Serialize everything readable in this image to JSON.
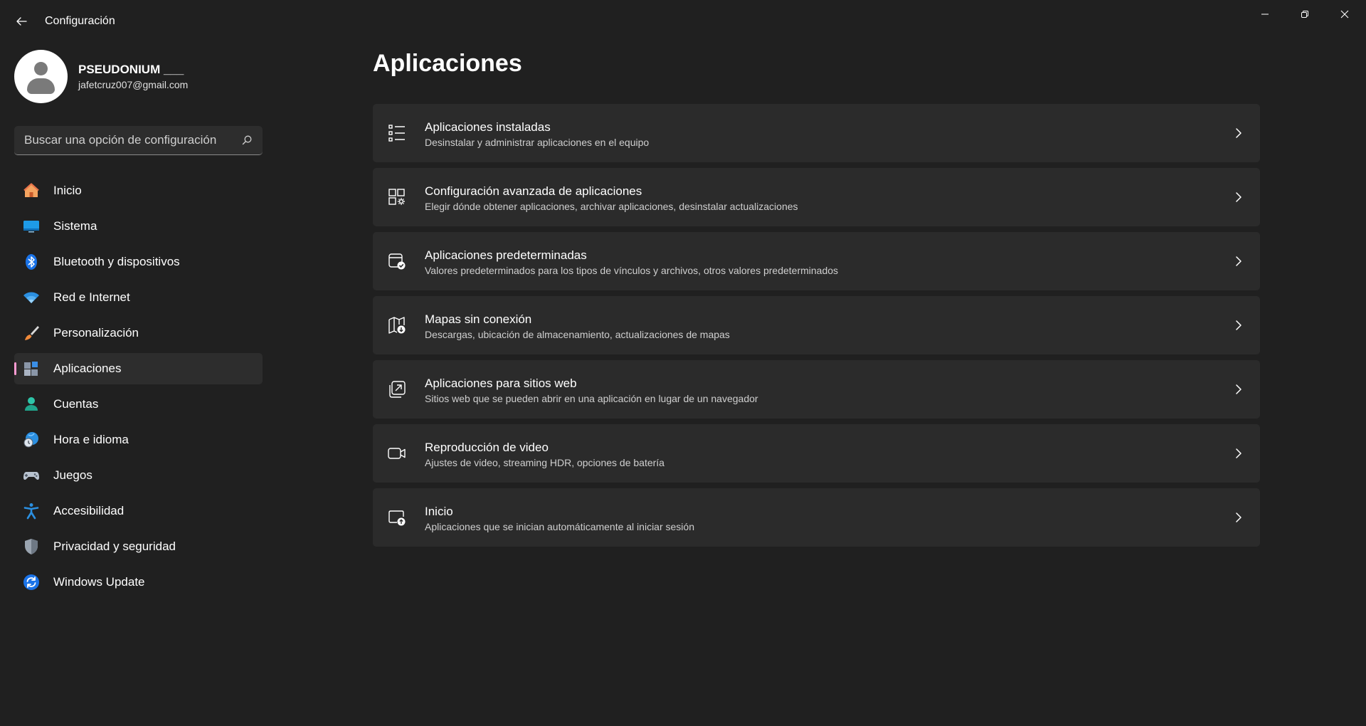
{
  "window": {
    "title": "Configuración"
  },
  "profile": {
    "name": "PSEUDONIUM ___",
    "email": "jafetcruz007@gmail.com"
  },
  "search": {
    "placeholder": "Buscar una opción de configuración"
  },
  "sidebar": {
    "items": [
      {
        "label": "Inicio",
        "icon": "home-icon"
      },
      {
        "label": "Sistema",
        "icon": "display-icon"
      },
      {
        "label": "Bluetooth y dispositivos",
        "icon": "bluetooth-icon"
      },
      {
        "label": "Red e Internet",
        "icon": "wifi-icon"
      },
      {
        "label": "Personalización",
        "icon": "brush-icon"
      },
      {
        "label": "Aplicaciones",
        "icon": "apps-icon",
        "active": true
      },
      {
        "label": "Cuentas",
        "icon": "person-icon"
      },
      {
        "label": "Hora e idioma",
        "icon": "globe-clock-icon"
      },
      {
        "label": "Juegos",
        "icon": "gamepad-icon"
      },
      {
        "label": "Accesibilidad",
        "icon": "accessibility-icon"
      },
      {
        "label": "Privacidad y seguridad",
        "icon": "shield-icon"
      },
      {
        "label": "Windows Update",
        "icon": "update-icon"
      }
    ]
  },
  "main": {
    "title": "Aplicaciones",
    "cards": [
      {
        "title": "Aplicaciones instaladas",
        "subtitle": "Desinstalar y administrar aplicaciones en el equipo",
        "icon": "list-icon"
      },
      {
        "title": "Configuración avanzada de aplicaciones",
        "subtitle": "Elegir dónde obtener aplicaciones, archivar aplicaciones, desinstalar actualizaciones",
        "icon": "apps-gear-icon"
      },
      {
        "title": "Aplicaciones predeterminadas",
        "subtitle": "Valores predeterminados para los tipos de vínculos y archivos, otros valores predeterminados",
        "icon": "default-apps-icon"
      },
      {
        "title": "Mapas sin conexión",
        "subtitle": "Descargas, ubicación de almacenamiento, actualizaciones de mapas",
        "icon": "map-download-icon"
      },
      {
        "title": "Aplicaciones para sitios web",
        "subtitle": "Sitios web que se pueden abrir en una aplicación en lugar de un navegador",
        "icon": "open-in-app-icon"
      },
      {
        "title": "Reproducción de video",
        "subtitle": "Ajustes de video, streaming HDR, opciones de batería",
        "icon": "video-icon"
      },
      {
        "title": "Inicio",
        "subtitle": "Aplicaciones que se inician automáticamente al iniciar sesión",
        "icon": "startup-icon"
      }
    ]
  },
  "colors": {
    "background": "#202020",
    "card": "#2b2b2b",
    "accent": "#ff9bd2"
  }
}
